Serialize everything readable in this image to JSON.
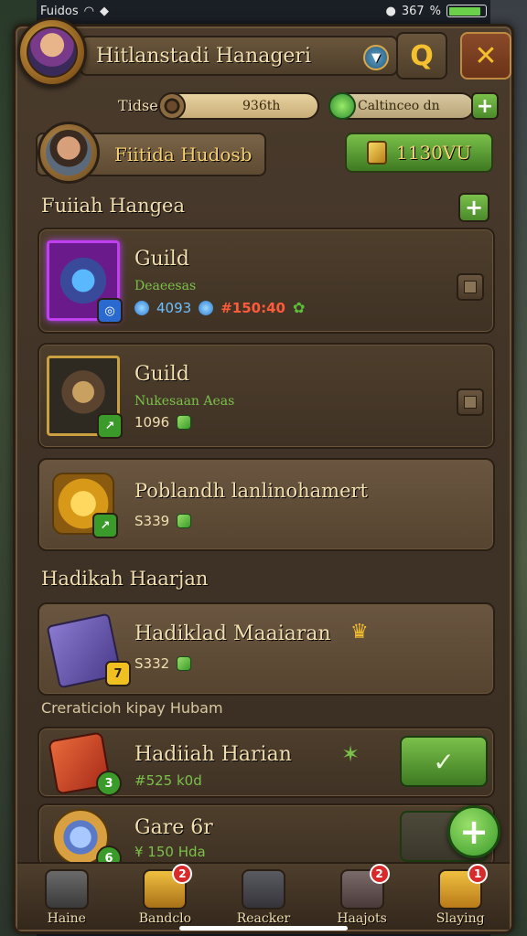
{
  "status_bar": {
    "carrier": "Fuidos",
    "time": "367",
    "signal": "%",
    "battery_pct": 0.85
  },
  "header": {
    "title": "Hitlanstadi Hanageri",
    "search_icon": "search-icon",
    "close_icon": "close-icon"
  },
  "currency": {
    "label": "Tidse",
    "coins_value": "936th",
    "gems_value": "Caltinceo dn",
    "add_label": "+"
  },
  "profile": {
    "name": "Fiitida Hudosb",
    "gold_value": "1130VU"
  },
  "sections": {
    "first_title": "Fuiiah Hangea",
    "second_title": "Hadikah Haarjan",
    "note": "Creraticioh kipay Hubam"
  },
  "items": [
    {
      "title": "Guild",
      "subtitle": "Deaeesas",
      "badge": "",
      "stat1": "4093",
      "stat2": "#150:40"
    },
    {
      "title": "Guild",
      "subtitle": "Nukesaan Aeas",
      "badge": "",
      "stat1": "1096"
    }
  ],
  "cards": [
    {
      "title": "Poblandh lanlinohamert",
      "stat": "S339"
    },
    {
      "title": "Hadiklad Maaiaran",
      "stat": "S332",
      "badge": "7"
    },
    {
      "title": "Hadiiah Harian",
      "stat": "#525 k0d",
      "badge": "3"
    },
    {
      "title": "Gare 6r",
      "stat": "¥ 150 Hda",
      "badge": "6"
    }
  ],
  "nav": [
    {
      "label": "Haine",
      "badge": ""
    },
    {
      "label": "Bandclo",
      "badge": "2"
    },
    {
      "label": "Reacker",
      "badge": ""
    },
    {
      "label": "Haajots",
      "badge": "2"
    },
    {
      "label": "Slaying",
      "badge": "1"
    }
  ],
  "colors": {
    "accent_green": "#7ac04a",
    "gold": "#f5c030",
    "panel_brown": "#4a3b2c",
    "text_cream": "#f2dfb0"
  }
}
